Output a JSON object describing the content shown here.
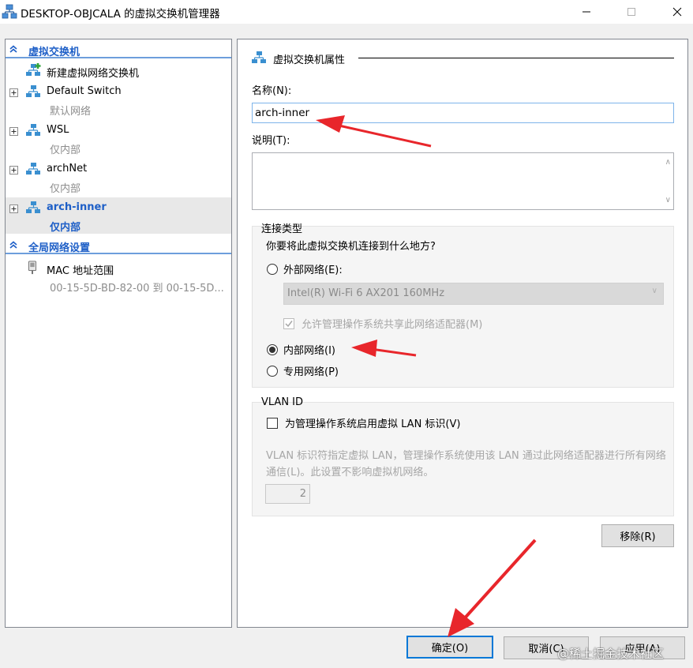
{
  "window": {
    "title": "DESKTOP-OBJCALA 的虚拟交换机管理器",
    "icons": {
      "app": "network-switch-icon",
      "minimize": "minimize-icon",
      "maximize": "maximize-icon",
      "close": "close-icon"
    }
  },
  "left": {
    "switch_section": {
      "label": "虚拟交换机",
      "icon": "chevron-collapse-icon"
    },
    "new_switch": {
      "label": "新建虚拟网络交换机",
      "icon": "add-network-icon"
    },
    "switches": [
      {
        "name": "Default Switch",
        "type": "默认网络",
        "selected": false
      },
      {
        "name": "WSL",
        "type": "仅内部",
        "selected": false
      },
      {
        "name": "archNet",
        "type": "仅内部",
        "selected": false
      },
      {
        "name": "arch-inner",
        "type": "仅内部",
        "selected": true
      }
    ],
    "global_section": {
      "label": "全局网络设置",
      "icon": "chevron-collapse-icon"
    },
    "mac": {
      "label": "MAC 地址范围",
      "value": "00-15-5D-BD-82-00 到 00-15-5D...",
      "icon": "mac-address-icon"
    }
  },
  "right": {
    "section_title": "虚拟交换机属性",
    "name_label": "名称(N):",
    "name_value": "arch-inner",
    "desc_label": "说明(T):",
    "desc_value": "",
    "connection": {
      "title": "连接类型",
      "question": "你要将此虚拟交换机连接到什么地方?",
      "external_label": "外部网络(E):",
      "adapter": "Intel(R) Wi-Fi 6 AX201 160MHz",
      "allow_share": "允许管理操作系统共享此网络适配器(M)",
      "internal_label": "内部网络(I)",
      "private_label": "专用网络(P)",
      "selected": "internal"
    },
    "vlan": {
      "title": "VLAN ID",
      "enable_label": "为管理操作系统启用虚拟 LAN 标识(V)",
      "description": "VLAN 标识符指定虚拟 LAN，管理操作系统使用该 LAN 通过此网络适配器进行所有网络通信(L)。此设置不影响虚拟机网络。",
      "id_value": "2"
    },
    "remove_button": "移除(R)"
  },
  "footer": {
    "ok": "确定(O)",
    "cancel": "取消(C)",
    "apply": "应用(A)"
  },
  "watermark": "@稀土掘金技术社区",
  "colors": {
    "accent": "#1e5fc7",
    "arrow": "#e8262b",
    "focus": "#0078d7"
  }
}
